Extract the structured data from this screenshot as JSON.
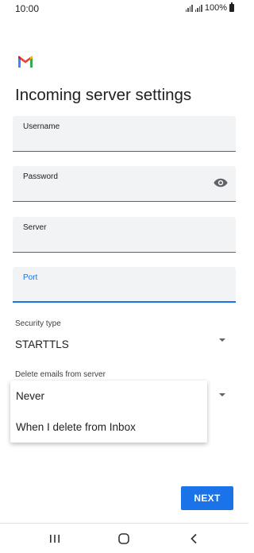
{
  "status_bar": {
    "time": "10:00",
    "battery": "100%"
  },
  "app": {
    "logo": "gmail-logo"
  },
  "page": {
    "title": "Incoming server settings"
  },
  "fields": {
    "username": {
      "label": "Username",
      "value": ""
    },
    "password": {
      "label": "Password",
      "value": "",
      "icon": "eye-icon"
    },
    "server": {
      "label": "Server",
      "value": ""
    },
    "port": {
      "label": "Port",
      "value": ""
    }
  },
  "security_type": {
    "label": "Security type",
    "value": "STARTTLS"
  },
  "delete_emails": {
    "label": "Delete emails from server"
  },
  "dropdown_menu": {
    "items": [
      "Never",
      "When I delete from Inbox"
    ]
  },
  "actions": {
    "next_label": "NEXT"
  },
  "nav": {
    "buttons": [
      "recent-apps-icon",
      "home-icon",
      "back-icon"
    ]
  },
  "colors": {
    "accent": "#1a73e8",
    "field_bg": "#f1f3f4"
  }
}
